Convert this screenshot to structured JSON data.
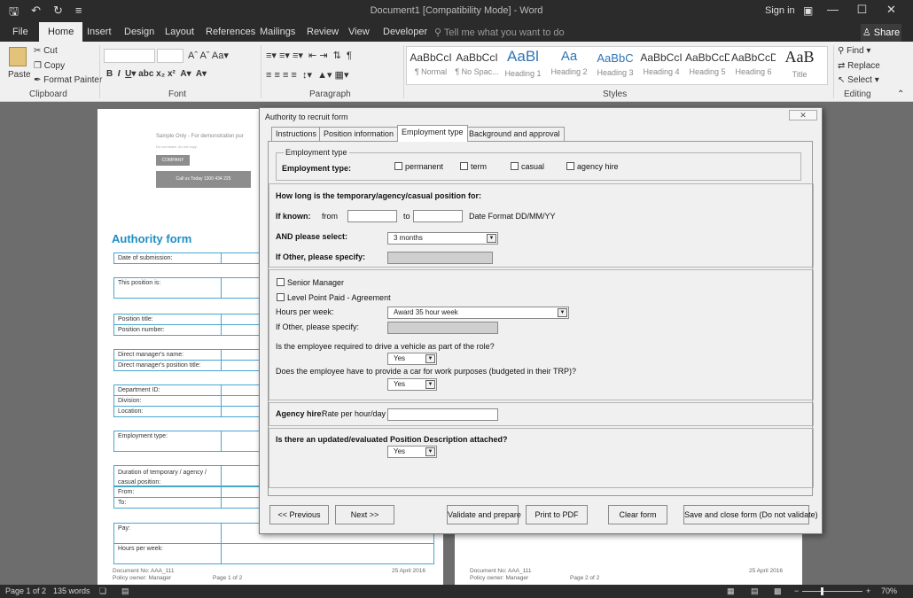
{
  "window": {
    "title": "Document1 [Compatibility Mode] - Word",
    "signin": "Sign in",
    "controls": [
      "—",
      "☐",
      "✕"
    ]
  },
  "ribbon_tabs": [
    "File",
    "Home",
    "Insert",
    "Design",
    "Layout",
    "References",
    "Mailings",
    "Review",
    "View",
    "Developer"
  ],
  "tellme": "Tell me what you want to do",
  "share": "Share",
  "clipboard": {
    "paste": "Paste",
    "cut": "Cut",
    "copy": "Copy",
    "format_painter": "Format Painter",
    "label": "Clipboard"
  },
  "font_group": {
    "label": "Font"
  },
  "paragraph_group": {
    "label": "Paragraph"
  },
  "styles_group": {
    "label": "Styles",
    "items": [
      {
        "sample": "AaBbCcI",
        "name": "¶ Normal"
      },
      {
        "sample": "AaBbCcI",
        "name": "¶ No Spac..."
      },
      {
        "sample": "AaBl",
        "name": "Heading 1"
      },
      {
        "sample": "Aa",
        "name": "Heading 2"
      },
      {
        "sample": "AaBbC",
        "name": "Heading 3"
      },
      {
        "sample": "AaBbCcI",
        "name": "Heading 4"
      },
      {
        "sample": "AaBbCcD",
        "name": "Heading 5"
      },
      {
        "sample": "AaBbCcD",
        "name": "Heading 6"
      },
      {
        "sample": "AaB",
        "name": "Title"
      }
    ]
  },
  "editing_group": {
    "find": "Find",
    "replace": "Replace",
    "select": "Select",
    "label": "Editing"
  },
  "document": {
    "sample_text": "Sample Only - For demonstration pur",
    "sample_sub": "Do not share, do not copy",
    "logo_btn": "COMPANY",
    "call_btn": "Call us Today 1300 434 225",
    "form_title": "Authority form",
    "rows": [
      "Date of submission:",
      "This position is:",
      "Position title:",
      "Position number:",
      "Direct manager's name:",
      "Direct manager's position title:",
      "Department ID:",
      "Division:",
      "Location:",
      "Employment type:",
      "Duration of temporary / agency / casual position:",
      "From:",
      "To:",
      "Pay:",
      "Hours per week:"
    ],
    "footer1": {
      "doc_no": "Document No: AAA_111",
      "owner": "Policy owner: Manager",
      "page": "Page 1 of 2",
      "date": "25 April 2016"
    },
    "footer2": {
      "doc_no": "Document No: AAA_111",
      "owner": "Policy owner: Manager",
      "page": "Page 2 of 2",
      "date": "25 April 2016"
    }
  },
  "status": {
    "page": "Page 1 of 2",
    "words": "135 words",
    "zoom": "70%"
  },
  "dialog": {
    "title": "Authority to recruit form",
    "tabs": [
      "Instructions",
      "Position information",
      "Employment type",
      "Background and approval"
    ],
    "employment_frame": "Employment type",
    "employment_type_label": "Employment type:",
    "options": [
      "permanent",
      "term",
      "casual",
      "agency hire"
    ],
    "how_long": "How long is the temporary/agency/casual position for:",
    "if_known": "If known:",
    "from": "from",
    "to": "to",
    "date_format": "Date Format DD/MM/YY",
    "and_select": "AND please select:",
    "duration_value": "3 months",
    "if_other": "If Other, please specify:",
    "senior_manager": "Senior Manager",
    "level_point": "Level Point Paid - Agreement",
    "hours_label": "Hours per week:",
    "hours_value": "Award 35 hour week",
    "if_other2": "If Other, please specify:",
    "drive_q": "Is the employee required to drive a vehicle as part of the role?",
    "drive_value": "Yes",
    "car_q": "Does the employee have to provide a car for work purposes (budgeted in their TRP)?",
    "car_value": "Yes",
    "agency_label": "Agency hire:",
    "agency_rate": "Rate per hour/day",
    "pd_q": "Is there an updated/evaluated Position Description attached?",
    "pd_value": "Yes",
    "buttons": {
      "previous": "<< Previous",
      "next": "Next >>",
      "validate": "Validate and prepare",
      "print": "Print to PDF",
      "clear": "Clear form",
      "save_close": "Save and close form (Do not validate)"
    }
  }
}
